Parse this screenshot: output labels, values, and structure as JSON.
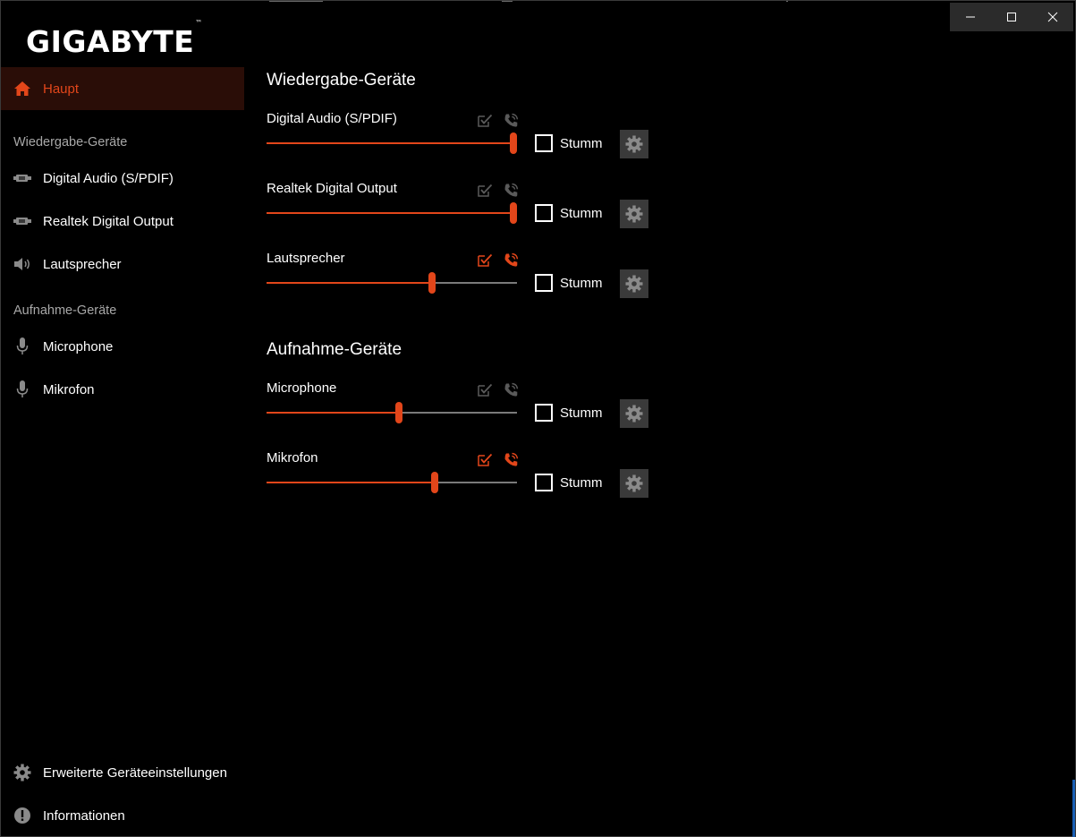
{
  "window": {
    "controls": {
      "minimize": "minimize-icon",
      "maximize": "maximize-icon",
      "close": "close-icon"
    }
  },
  "brand": {
    "logo_text": "GIGABYTE",
    "trademark": "™"
  },
  "colors": {
    "accent": "#e2461a",
    "active_bg": "#2a0d07",
    "muted_icon": "#5a5a5a",
    "section_text": "#a8a8a8"
  },
  "sidebar": {
    "home": {
      "label": "Haupt",
      "icon": "home-icon"
    },
    "playback_section": "Wiedergabe-Geräte",
    "playback_items": [
      {
        "label": "Digital Audio (S/PDIF)",
        "icon": "spdif-connector-icon"
      },
      {
        "label": "Realtek Digital Output",
        "icon": "spdif-connector-icon"
      },
      {
        "label": "Lautsprecher",
        "icon": "speaker-icon"
      }
    ],
    "recording_section": "Aufnahme-Geräte",
    "recording_items": [
      {
        "label": "Microphone",
        "icon": "microphone-icon"
      },
      {
        "label": "Mikrofon",
        "icon": "microphone-icon"
      }
    ],
    "bottom_items": [
      {
        "label": "Erweiterte Geräteeinstellungen",
        "icon": "gear-icon"
      },
      {
        "label": "Informationen",
        "icon": "info-icon"
      }
    ]
  },
  "main": {
    "playback_title": "Wiedergabe-Geräte",
    "recording_title": "Aufnahme-Geräte",
    "mute_label": "Stumm",
    "playback_devices": [
      {
        "name": "Digital Audio (S/PDIF)",
        "volume": 1.0,
        "muted": false,
        "default": false,
        "default_comm": false
      },
      {
        "name": "Realtek Digital Output",
        "volume": 1.0,
        "muted": false,
        "default": false,
        "default_comm": false
      },
      {
        "name": "Lautsprecher",
        "volume": 0.66,
        "muted": false,
        "default": true,
        "default_comm": true
      }
    ],
    "recording_devices": [
      {
        "name": "Microphone",
        "volume": 0.53,
        "muted": false,
        "default": false,
        "default_comm": false
      },
      {
        "name": "Mikrofon",
        "volume": 0.67,
        "muted": false,
        "default": true,
        "default_comm": true
      }
    ]
  }
}
